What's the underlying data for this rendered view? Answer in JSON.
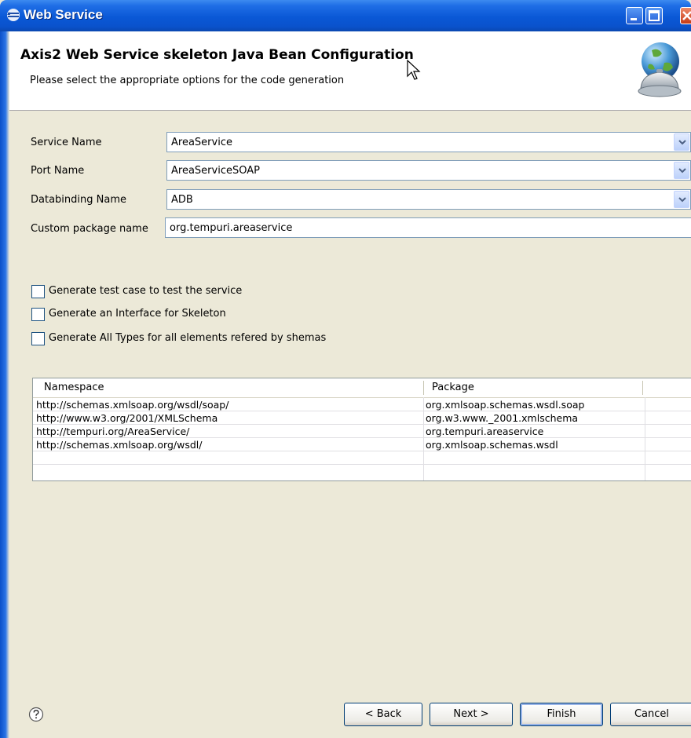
{
  "window": {
    "title": "Web Service"
  },
  "header": {
    "title": "Axis2 Web Service skeleton Java Bean Configuration",
    "description": "Please select the appropriate options for the code generation"
  },
  "form": {
    "service_name": {
      "label": "Service Name",
      "value": "AreaService"
    },
    "port_name": {
      "label": "Port Name",
      "value": "AreaServiceSOAP"
    },
    "databinding_name": {
      "label": "Databinding Name",
      "value": "ADB"
    },
    "custom_package": {
      "label": "Custom package name",
      "value": "org.tempuri.areaservice"
    }
  },
  "options": [
    {
      "label": "Generate test case to test the service",
      "checked": false
    },
    {
      "label": "Generate an Interface for Skeleton",
      "checked": false
    },
    {
      "label": "Generate All Types for all elements refered by shemas",
      "checked": false
    }
  ],
  "table": {
    "columns": [
      "Namespace",
      "Package"
    ],
    "rows": [
      [
        "http://schemas.xmlsoap.org/wsdl/soap/",
        "org.xmlsoap.schemas.wsdl.soap"
      ],
      [
        "http://www.w3.org/2001/XMLSchema",
        "org.w3.www._2001.xmlschema"
      ],
      [
        "http://tempuri.org/AreaService/",
        "org.tempuri.areaservice"
      ],
      [
        "http://schemas.xmlsoap.org/wsdl/",
        "org.xmlsoap.schemas.wsdl"
      ]
    ]
  },
  "buttons": {
    "back": "< Back",
    "next": "Next >",
    "finish": "Finish",
    "cancel": "Cancel"
  },
  "icons": {
    "help": "help-icon",
    "header": "globe-service-icon",
    "title": "web-service-icon"
  },
  "colors": {
    "titlebar": "#0a58d6",
    "dialog_bg": "#ece9d8",
    "field_border": "#7f9db9"
  }
}
